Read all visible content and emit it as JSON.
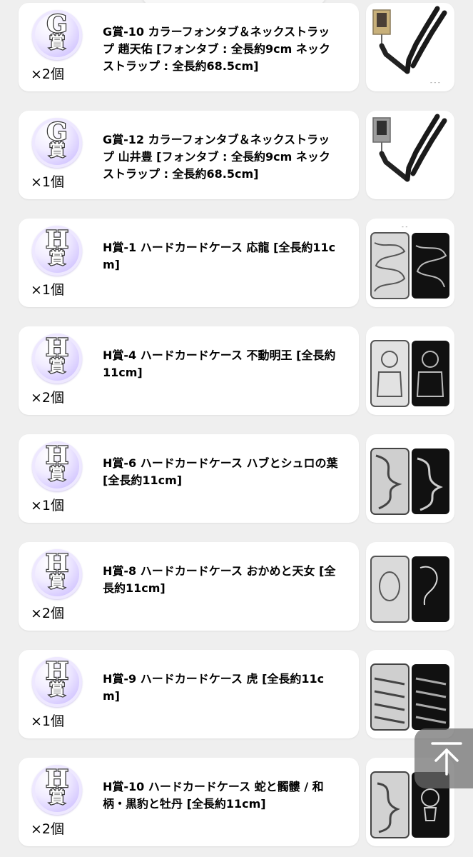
{
  "items": [
    {
      "grade_letter": "G",
      "grade_kanji": "賞",
      "title": "G賞-10 カラーフォンタブ＆ネックストラップ 趙天佑 [フォンタブ : 全長約9cm ネックストラップ : 全長約68.5cm]",
      "quantity": "×2個",
      "thumbnail": "lanyard-photo"
    },
    {
      "grade_letter": "G",
      "grade_kanji": "賞",
      "title": "G賞-12 カラーフォンタブ＆ネックストラップ 山井豊 [フォンタブ : 全長約9cm ネックストラップ : 全長約68.5cm]",
      "quantity": "×1個",
      "thumbnail": "lanyard-photo"
    },
    {
      "grade_letter": "H",
      "grade_kanji": "賞",
      "title": "H賞-1 ハードカードケース 応龍 [全長約11cm]",
      "quantity": "×1個",
      "thumbnail": "card-case-photo"
    },
    {
      "grade_letter": "H",
      "grade_kanji": "賞",
      "title": "H賞-4 ハードカードケース 不動明王 [全長約11cm]",
      "quantity": "×2個",
      "thumbnail": "card-case-photo"
    },
    {
      "grade_letter": "H",
      "grade_kanji": "賞",
      "title": "H賞-6 ハードカードケース ハブとシュロの葉 [全長約11cm]",
      "quantity": "×1個",
      "thumbnail": "card-case-photo"
    },
    {
      "grade_letter": "H",
      "grade_kanji": "賞",
      "title": "H賞-8 ハードカードケース おかめと天女 [全長約11cm]",
      "quantity": "×2個",
      "thumbnail": "card-case-photo"
    },
    {
      "grade_letter": "H",
      "grade_kanji": "賞",
      "title": "H賞-9 ハードカードケース 虎 [全長約11cm]",
      "quantity": "×1個",
      "thumbnail": "card-case-photo"
    },
    {
      "grade_letter": "H",
      "grade_kanji": "賞",
      "title": "H賞-10 ハードカードケース 蛇と髑髏 / 和柄・黒豹と牡丹 [全長約11cm]",
      "quantity": "×2個",
      "thumbnail": "card-case-photo"
    }
  ],
  "scroll_top_button": {
    "icon": "arrow-up-to-top-icon"
  },
  "colors": {
    "background": "#efefef",
    "card": "#ffffff",
    "badge_purple": "#c9b8ff"
  }
}
